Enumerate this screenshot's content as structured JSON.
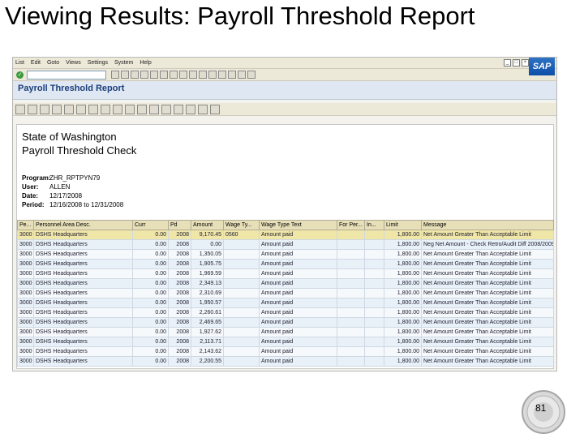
{
  "slide": {
    "title": "Viewing Results: Payroll Threshold Report",
    "page_number": "81"
  },
  "sap": {
    "menu": [
      "List",
      "Edit",
      "Goto",
      "Views",
      "Settings",
      "System",
      "Help"
    ],
    "logo": "SAP",
    "screen_title": "Payroll Threshold Report",
    "report": {
      "heading1": "State of Washington",
      "heading2": "Payroll Threshold Check",
      "info": [
        {
          "label": "Program:",
          "value": "ZHR_RPTPYN79"
        },
        {
          "label": "User:",
          "value": "ALLEN"
        },
        {
          "label": "Date:",
          "value": "12/17/2008"
        },
        {
          "label": "Period:",
          "value": "12/16/2008 to 12/31/2008"
        }
      ],
      "columns": [
        "Pe...",
        "Personnel Area Desc.",
        "Curr",
        "Pd",
        "Amount",
        "Wage Ty...",
        "Wage Type Text",
        "For Per...",
        "In...",
        "Limit",
        "Message"
      ],
      "rows": [
        [
          "3000",
          "DSHS Headquarters",
          "0.00",
          "2008",
          "9,170.45",
          "0560",
          "Amount paid",
          "",
          "",
          "1,800.00",
          "Net Amount Greater Than Acceptable Limit"
        ],
        [
          "3000",
          "DSHS Headquarters",
          "0.00",
          "2008",
          "0.00",
          "",
          "Amount paid",
          "",
          "",
          "1,800.00",
          "Neg Net Amount - Check Retro/Audit Diff 2008/2009"
        ],
        [
          "3000",
          "DSHS Headquarters",
          "0.00",
          "2008",
          "1,350.05",
          "",
          "Amount paid",
          "",
          "",
          "1,800.00",
          "Net Amount Greater Than Acceptable Limit"
        ],
        [
          "3000",
          "DSHS Headquarters",
          "0.00",
          "2008",
          "1,905.75",
          "",
          "Amount paid",
          "",
          "",
          "1,800.00",
          "Net Amount Greater Than Acceptable Limit"
        ],
        [
          "3000",
          "DSHS Headquarters",
          "0.00",
          "2008",
          "1,969.59",
          "",
          "Amount paid",
          "",
          "",
          "1,800.00",
          "Net Amount Greater Than Acceptable Limit"
        ],
        [
          "3000",
          "DSHS Headquarters",
          "0.00",
          "2008",
          "2,349.13",
          "",
          "Amount paid",
          "",
          "",
          "1,800.00",
          "Net Amount Greater Than Acceptable Limit"
        ],
        [
          "3000",
          "DSHS Headquarters",
          "0.00",
          "2008",
          "2,310.69",
          "",
          "Amount paid",
          "",
          "",
          "1,800.00",
          "Net Amount Greater Than Acceptable Limit"
        ],
        [
          "3000",
          "DSHS Headquarters",
          "0.00",
          "2008",
          "1,950.57",
          "",
          "Amount paid",
          "",
          "",
          "1,800.00",
          "Net Amount Greater Than Acceptable Limit"
        ],
        [
          "3000",
          "DSHS Headquarters",
          "0.00",
          "2008",
          "2,260.61",
          "",
          "Amount paid",
          "",
          "",
          "1,800.00",
          "Net Amount Greater Than Acceptable Limit"
        ],
        [
          "3000",
          "DSHS Headquarters",
          "0.00",
          "2008",
          "2,469.65",
          "",
          "Amount paid",
          "",
          "",
          "1,800.00",
          "Net Amount Greater Than Acceptable Limit"
        ],
        [
          "3000",
          "DSHS Headquarters",
          "0.00",
          "2008",
          "1,927.62",
          "",
          "Amount paid",
          "",
          "",
          "1,800.00",
          "Net Amount Greater Than Acceptable Limit"
        ],
        [
          "3000",
          "DSHS Headquarters",
          "0.00",
          "2008",
          "2,113.71",
          "",
          "Amount paid",
          "",
          "",
          "1,800.00",
          "Net Amount Greater Than Acceptable Limit"
        ],
        [
          "3000",
          "DSHS Headquarters",
          "0.00",
          "2008",
          "2,143.62",
          "",
          "Amount paid",
          "",
          "",
          "1,800.00",
          "Net Amount Greater Than Acceptable Limit"
        ],
        [
          "3000",
          "DSHS Headquarters",
          "0.00",
          "2008",
          "2,200.55",
          "",
          "Amount paid",
          "",
          "",
          "1,800.00",
          "Net Amount Greater Than Acceptable Limit"
        ]
      ]
    }
  },
  "colors": {
    "header_bg": "#e6dfb8",
    "title_blue": "#1b3e7a"
  }
}
